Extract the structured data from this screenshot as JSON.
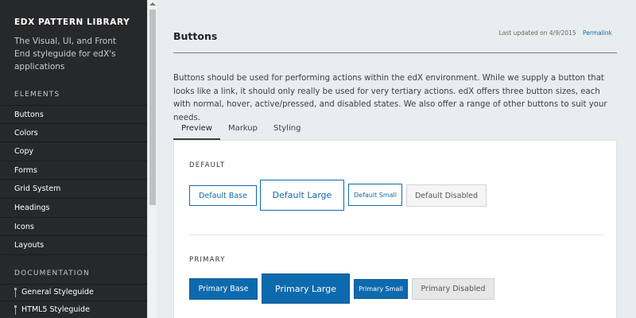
{
  "sidebar": {
    "title": "EDX PATTERN LIBRARY",
    "description": "The Visual, UI, and Front End styleguide for edX's applications",
    "elements_heading": "ELEMENTS",
    "elements": [
      "Buttons",
      "Colors",
      "Copy",
      "Forms",
      "Grid System",
      "Headings",
      "Icons",
      "Layouts"
    ],
    "documentation_heading": "DOCUMENTATION",
    "documentation": [
      "General Styleguide",
      "HTML5 Styleguide"
    ]
  },
  "header": {
    "title": "Buttons",
    "last_updated": "Last updated on 4/9/2015",
    "permalink": "Permalink"
  },
  "intro": "Buttons should be used for performing actions within the edX environment. While we supply a button that looks like a link, it should only really be used for very tertiary actions. edX offers three button sizes, each with normal, hover, active/pressed, and disabled states. We also offer a range of other buttons to suit your needs.",
  "tabs": [
    "Preview",
    "Markup",
    "Styling"
  ],
  "default_group": {
    "label": "DEFAULT",
    "base": "Default Base",
    "large": "Default Large",
    "small": "Default Small",
    "disabled": "Default Disabled"
  },
  "primary_group": {
    "label": "PRIMARY",
    "base": "Primary Base",
    "large": "Primary Large",
    "small": "Primary Small",
    "disabled": "Primary Disabled"
  },
  "colors": {
    "sidebar_bg": "#27282a",
    "accent": "#0e6aae",
    "page_bg": "#e9edf0"
  }
}
